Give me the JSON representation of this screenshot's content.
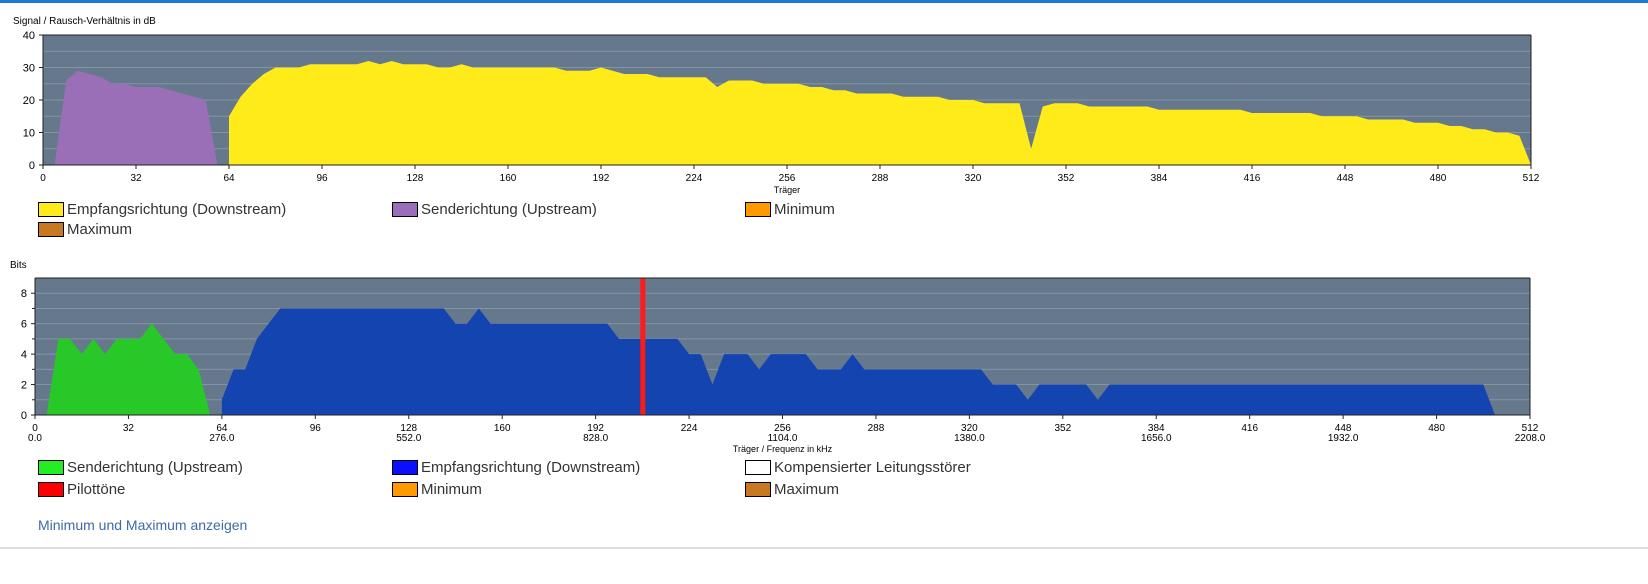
{
  "link_label": "Minimum und Maximum anzeigen",
  "chart_data": [
    {
      "type": "area",
      "title": "Signal / Rausch-Verhältnis in dB",
      "xlabel": "Träger",
      "ylim": [
        0,
        40
      ],
      "xlim": [
        0,
        512
      ],
      "yticks": [
        "0",
        "10",
        "20",
        "30",
        "40"
      ],
      "xticks": [
        "0",
        "32",
        "64",
        "96",
        "128",
        "160",
        "192",
        "224",
        "256",
        "288",
        "320",
        "352",
        "384",
        "416",
        "448",
        "480",
        "512"
      ],
      "legend": [
        {
          "label": "Empfangsrichtung (Downstream)",
          "color": "#ffea1a"
        },
        {
          "label": "Senderichtung (Upstream)",
          "color": "#9b6fb8"
        },
        {
          "label": "Minimum",
          "color": "#ff9900"
        },
        {
          "label": "Maximum",
          "color": "#c87820"
        }
      ],
      "series": [
        {
          "name": "Senderichtung (Upstream)",
          "color": "#9b6fb8",
          "x_start": 0,
          "x_step": 4,
          "values": [
            0,
            0,
            26,
            29,
            28,
            27,
            25,
            25,
            24,
            24,
            24,
            23,
            22,
            21,
            20,
            0,
            0
          ]
        },
        {
          "name": "Empfangsrichtung (Downstream)",
          "color": "#ffea1a",
          "x_start": 64,
          "x_step": 4,
          "values": [
            15,
            21,
            25,
            28,
            30,
            30,
            30,
            31,
            31,
            31,
            31,
            31,
            32,
            31,
            32,
            31,
            31,
            31,
            30,
            30,
            31,
            30,
            30,
            30,
            30,
            30,
            30,
            30,
            30,
            29,
            29,
            29,
            30,
            29,
            28,
            28,
            28,
            27,
            27,
            27,
            27,
            27,
            24,
            26,
            26,
            26,
            25,
            25,
            25,
            25,
            24,
            24,
            23,
            23,
            22,
            22,
            22,
            22,
            21,
            21,
            21,
            21,
            20,
            20,
            20,
            19,
            19,
            19,
            19,
            5,
            18,
            19,
            19,
            19,
            18,
            18,
            18,
            18,
            18,
            18,
            17,
            17,
            17,
            17,
            17,
            17,
            17,
            17,
            16,
            16,
            16,
            16,
            16,
            16,
            15,
            15,
            15,
            15,
            14,
            14,
            14,
            14,
            13,
            13,
            13,
            12,
            12,
            11,
            11,
            10,
            10,
            9,
            0
          ]
        }
      ]
    },
    {
      "type": "area",
      "title": "Bits",
      "xlabel": "Träger / Frequenz in kHz",
      "ylim": [
        0,
        9
      ],
      "xlim": [
        0,
        512
      ],
      "yticks": [
        "0",
        "2",
        "4",
        "6",
        "8"
      ],
      "xticks": [
        "0",
        "32",
        "64",
        "96",
        "128",
        "160",
        "192",
        "224",
        "256",
        "288",
        "320",
        "352",
        "384",
        "416",
        "448",
        "480",
        "512"
      ],
      "xticks_khz": [
        "0.0",
        "276.0",
        "552.0",
        "828.0",
        "1104.0",
        "1380.0",
        "1656.0",
        "1932.0",
        "2208.0"
      ],
      "pilot_carrier": 208,
      "legend": [
        {
          "label": "Senderichtung (Upstream)",
          "color": "#22ee22"
        },
        {
          "label": "Empfangsrichtung (Downstream)",
          "color": "#0a10ff"
        },
        {
          "label": "Kompensierter Leitungsstörer",
          "color": "#ffffff"
        },
        {
          "label": "Pilottöne",
          "color": "#ff0000"
        },
        {
          "label": "Minimum",
          "color": "#ff9900"
        },
        {
          "label": "Maximum",
          "color": "#c87820"
        }
      ],
      "series": [
        {
          "name": "Senderichtung (Upstream)",
          "color": "#28c828",
          "x_start": 0,
          "x_step": 4,
          "values": [
            0,
            0,
            5,
            5,
            4,
            5,
            4,
            5,
            5,
            5,
            6,
            5,
            4,
            4,
            3,
            0,
            0
          ]
        },
        {
          "name": "Empfangsrichtung (Downstream)",
          "color": "#1444b0",
          "x_start": 64,
          "x_step": 4,
          "values": [
            1,
            3,
            3,
            5,
            6,
            7,
            7,
            7,
            7,
            7,
            7,
            7,
            7,
            7,
            7,
            7,
            7,
            7,
            7,
            7,
            6,
            6,
            7,
            6,
            6,
            6,
            6,
            6,
            6,
            6,
            6,
            6,
            6,
            6,
            5,
            5,
            5,
            5,
            5,
            5,
            4,
            4,
            2,
            4,
            4,
            4,
            3,
            4,
            4,
            4,
            4,
            3,
            3,
            3,
            4,
            3,
            3,
            3,
            3,
            3,
            3,
            3,
            3,
            3,
            3,
            3,
            2,
            2,
            2,
            1,
            2,
            2,
            2,
            2,
            2,
            1,
            2,
            2,
            2,
            2,
            2,
            2,
            2,
            2,
            2,
            2,
            2,
            2,
            2,
            2,
            2,
            2,
            2,
            2,
            2,
            2,
            2,
            2,
            2,
            2,
            2,
            2,
            2,
            2,
            2,
            2,
            2,
            2,
            2,
            0,
            0,
            0,
            0
          ]
        }
      ]
    }
  ]
}
